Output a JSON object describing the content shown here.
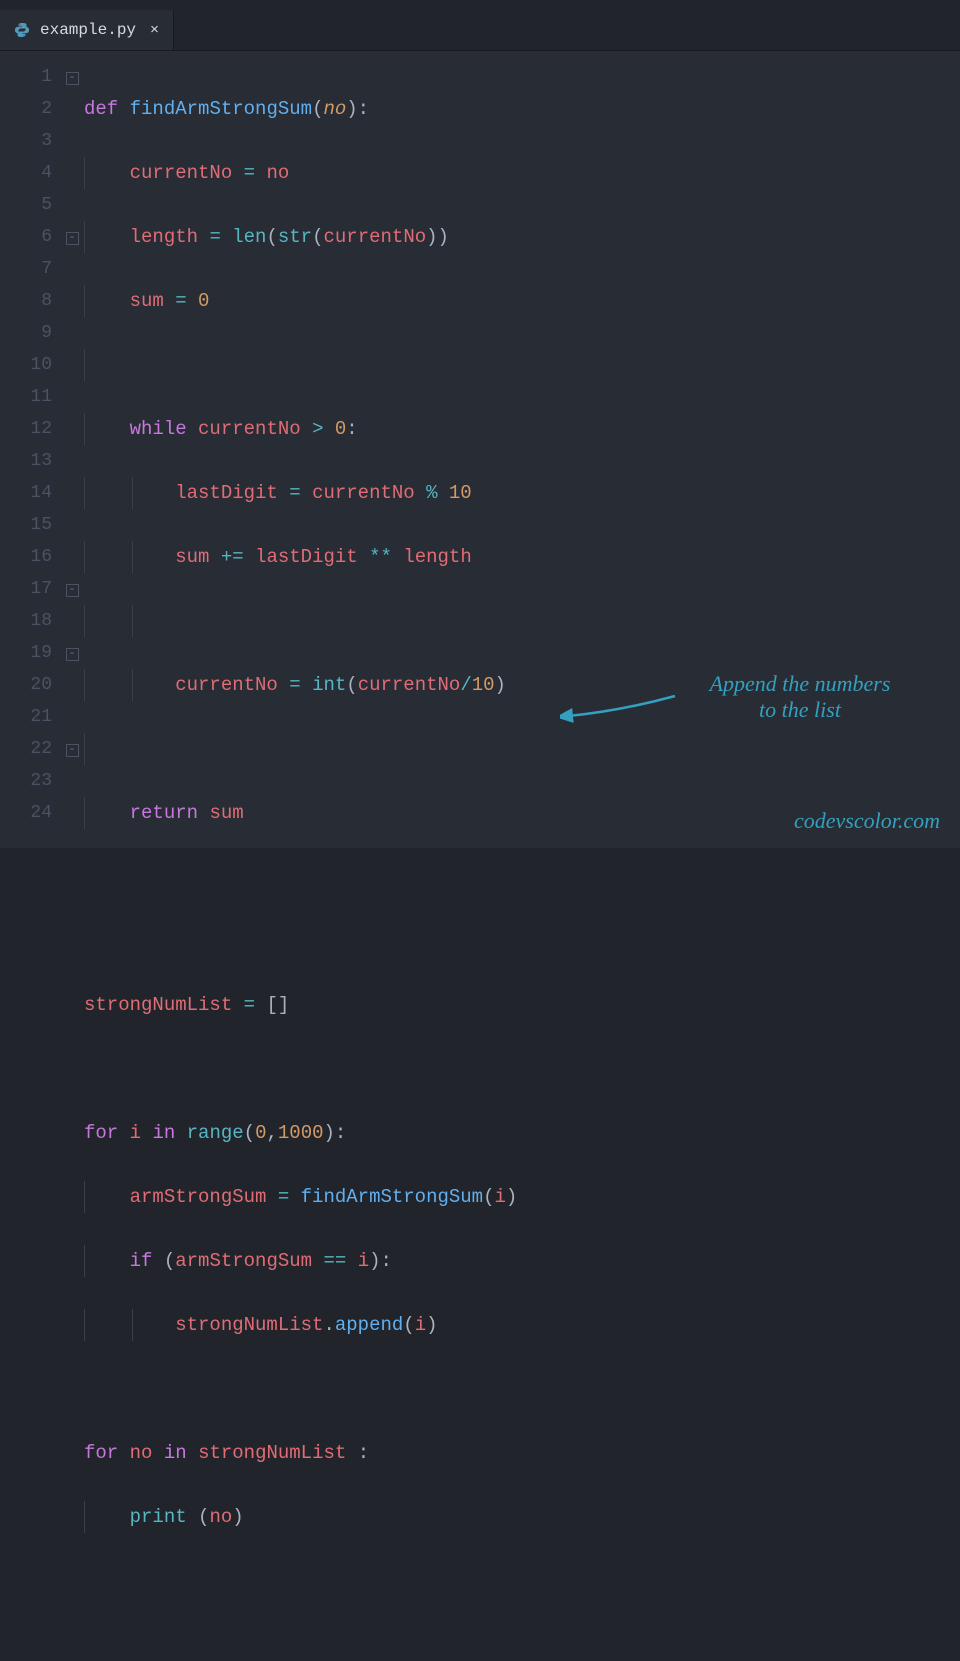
{
  "tab": {
    "filename": "example.py",
    "icon": "python-file-icon",
    "close": "×"
  },
  "lines": [
    1,
    2,
    3,
    4,
    5,
    6,
    7,
    8,
    9,
    10,
    11,
    12,
    13,
    14,
    15,
    16,
    17,
    18,
    19,
    20,
    21,
    22,
    23,
    24
  ],
  "folds": {
    "1": "-",
    "6": "-",
    "17": "-",
    "19": "-",
    "22": "-"
  },
  "code": {
    "l1": {
      "kw_def": "def",
      "fn": "findArmStrongSum",
      "prm": "no"
    },
    "l2": {
      "v1": "currentNo",
      "op": "=",
      "v2": "no"
    },
    "l3": {
      "v1": "length",
      "op": "=",
      "bi_len": "len",
      "bi_str": "str",
      "arg": "currentNo"
    },
    "l4": {
      "v1": "sum",
      "op": "=",
      "n": "0"
    },
    "l6": {
      "kw": "while",
      "v": "currentNo",
      "op": ">",
      "n": "0"
    },
    "l7": {
      "v1": "lastDigit",
      "op": "=",
      "v2": "currentNo",
      "op2": "%",
      "n": "10"
    },
    "l8": {
      "v1": "sum",
      "op": "+=",
      "v2": "lastDigit",
      "op2": "**",
      "v3": "length"
    },
    "l10": {
      "v1": "currentNo",
      "op": "=",
      "bi": "int",
      "arg": "currentNo",
      "op2": "/",
      "n": "10"
    },
    "l12": {
      "kw": "return",
      "v": "sum"
    },
    "l15": {
      "v": "strongNumList",
      "op": "="
    },
    "l17": {
      "kw_for": "for",
      "v": "i",
      "kw_in": "in",
      "bi": "range",
      "n1": "0",
      "n2": "1000"
    },
    "l18": {
      "v1": "armStrongSum",
      "op": "=",
      "fn": "findArmStrongSum",
      "arg": "i"
    },
    "l19": {
      "kw": "if",
      "v1": "armStrongSum",
      "op": "==",
      "v2": "i"
    },
    "l20": {
      "v": "strongNumList",
      "attr": "append",
      "arg": "i"
    },
    "l22": {
      "kw_for": "for",
      "v": "no",
      "kw_in": "in",
      "v2": "strongNumList"
    },
    "l23": {
      "bi": "print",
      "arg": "no"
    }
  },
  "annotation": {
    "text_line1": "Append the numbers",
    "text_line2": "to the list"
  },
  "watermark": "codevscolor.com"
}
